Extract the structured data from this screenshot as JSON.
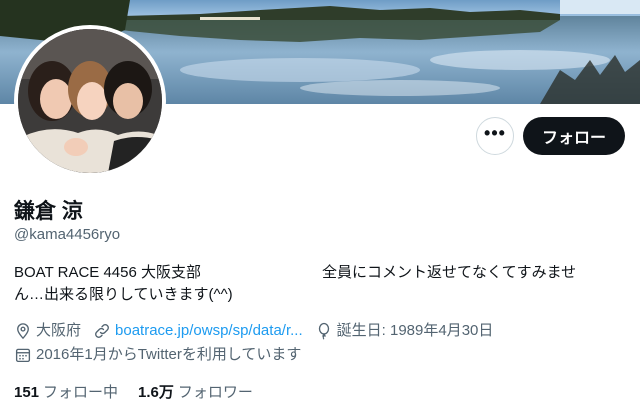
{
  "profile": {
    "display_name": "鎌倉 涼",
    "handle": "@kama4456ryo",
    "bio_line1_left": "BOAT RACE 4456 大阪支部",
    "bio_line1_right": "全員にコメント返せてなくてすみませ",
    "bio_line2": "ん…出来る限りしていきます(^^)",
    "location": "大阪府",
    "website": "boatrace.jp/owsp/sp/data/r...",
    "birthday": "誕生日: 1989年4月30日",
    "joined": "2016年1月からTwitterを利用しています"
  },
  "actions": {
    "more_label": "•••",
    "follow_label": "フォロー"
  },
  "stats": {
    "following_count": "151",
    "following_label": "フォロー中",
    "followers_count": "1.6万",
    "followers_label": "フォロワー"
  },
  "colors": {
    "text_primary": "#0f1419",
    "text_secondary": "#536471",
    "link": "#1d9bf0",
    "follow_bg": "#0f1419"
  },
  "icons": {
    "location": "location-pin-icon",
    "link": "link-icon",
    "birthday": "balloon-icon",
    "joined": "calendar-icon",
    "more": "more-dots-icon"
  }
}
